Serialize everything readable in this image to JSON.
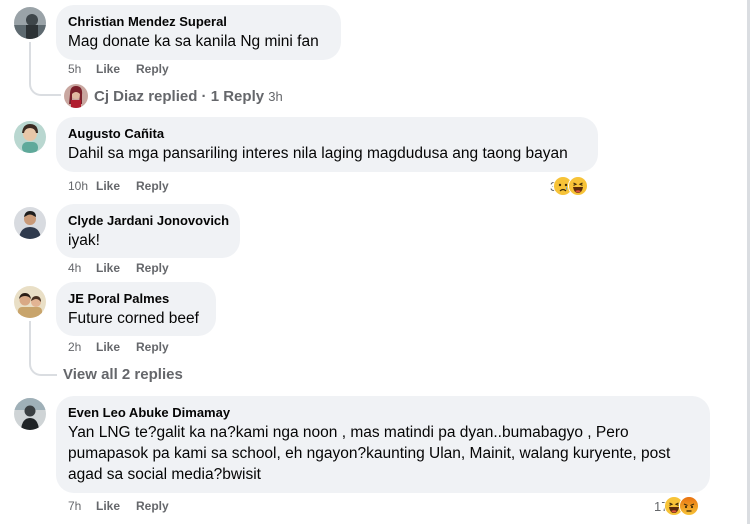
{
  "comments": [
    {
      "author": "Christian Mendez Superal",
      "text": "Mag donate ka sa kanila Ng mini fan",
      "time": "5h",
      "like": "Like",
      "reply": "Reply"
    },
    {
      "author": "Augusto Cañita",
      "text": "Dahil sa mga pansariling interes nila laging magdudusa ang taong bayan",
      "time": "10h",
      "like": "Like",
      "reply": "Reply",
      "reaction_count": "3"
    },
    {
      "author": "Clyde Jardani Jonovovich",
      "text": "iyak!",
      "time": "4h",
      "like": "Like",
      "reply": "Reply"
    },
    {
      "author": "JE Poral Palmes",
      "text": "Future corned beef",
      "time": "2h",
      "like": "Like",
      "reply": "Reply"
    },
    {
      "author": "Even Leo Abuke Dimamay",
      "text_lines": [
        "Yan LNG te?galit ka na?kami nga noon , mas matindi pa dyan..bumabagyo , Pero",
        "pumapasok pa kami sa school, eh ngayon?kaunting Ulan, Mainit, walang kuryente, post",
        "agad sa social media?bwisit"
      ],
      "time": "7h",
      "like": "Like",
      "reply": "Reply",
      "reaction_count": "17"
    }
  ],
  "reply_summary": {
    "name": "Cj Diaz",
    "action": "replied",
    "separator": "·",
    "count_label": "1 Reply",
    "time": "3h"
  },
  "view_replies": "View all 2 replies",
  "icons": {
    "haha": "haha-reaction-icon",
    "sad": "sad-reaction-icon",
    "angry": "angry-reaction-icon"
  },
  "colors": {
    "bubble": "#f0f2f5",
    "secondary_text": "#65676b",
    "reaction_yellow": "#f7c338",
    "reaction_angry": "#e9710f"
  }
}
